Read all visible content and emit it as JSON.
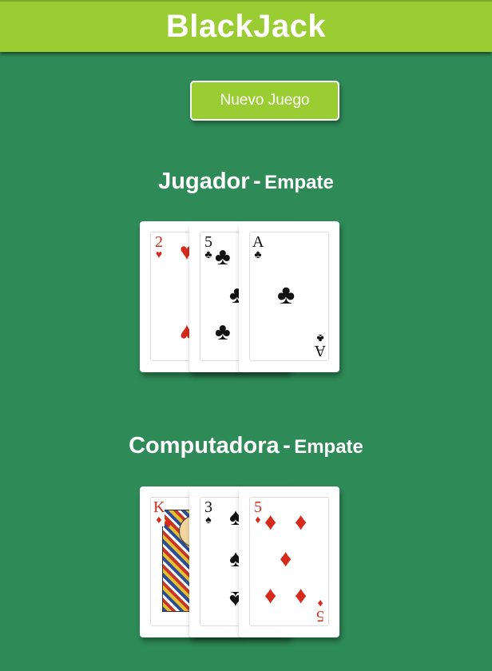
{
  "header": {
    "title": "BlackJack"
  },
  "controls": {
    "new_game_label": "Nuevo Juego"
  },
  "player": {
    "name": "Jugador",
    "separator": "-",
    "result": "Empate",
    "cards": [
      {
        "rank": "2",
        "suit": "♥",
        "color": "red"
      },
      {
        "rank": "5",
        "suit": "♣",
        "color": "black"
      },
      {
        "rank": "A",
        "suit": "♣",
        "color": "black"
      }
    ]
  },
  "computer": {
    "name": "Computadora",
    "separator": "-",
    "result": "Empate",
    "cards": [
      {
        "rank": "K",
        "suit": "♦",
        "color": "red"
      },
      {
        "rank": "3",
        "suit": "♠",
        "color": "black"
      },
      {
        "rank": "5",
        "suit": "♦",
        "color": "red"
      }
    ]
  },
  "colors": {
    "table": "#2e8b57",
    "accent": "#9acd32",
    "red_suit": "#d52a1c"
  }
}
